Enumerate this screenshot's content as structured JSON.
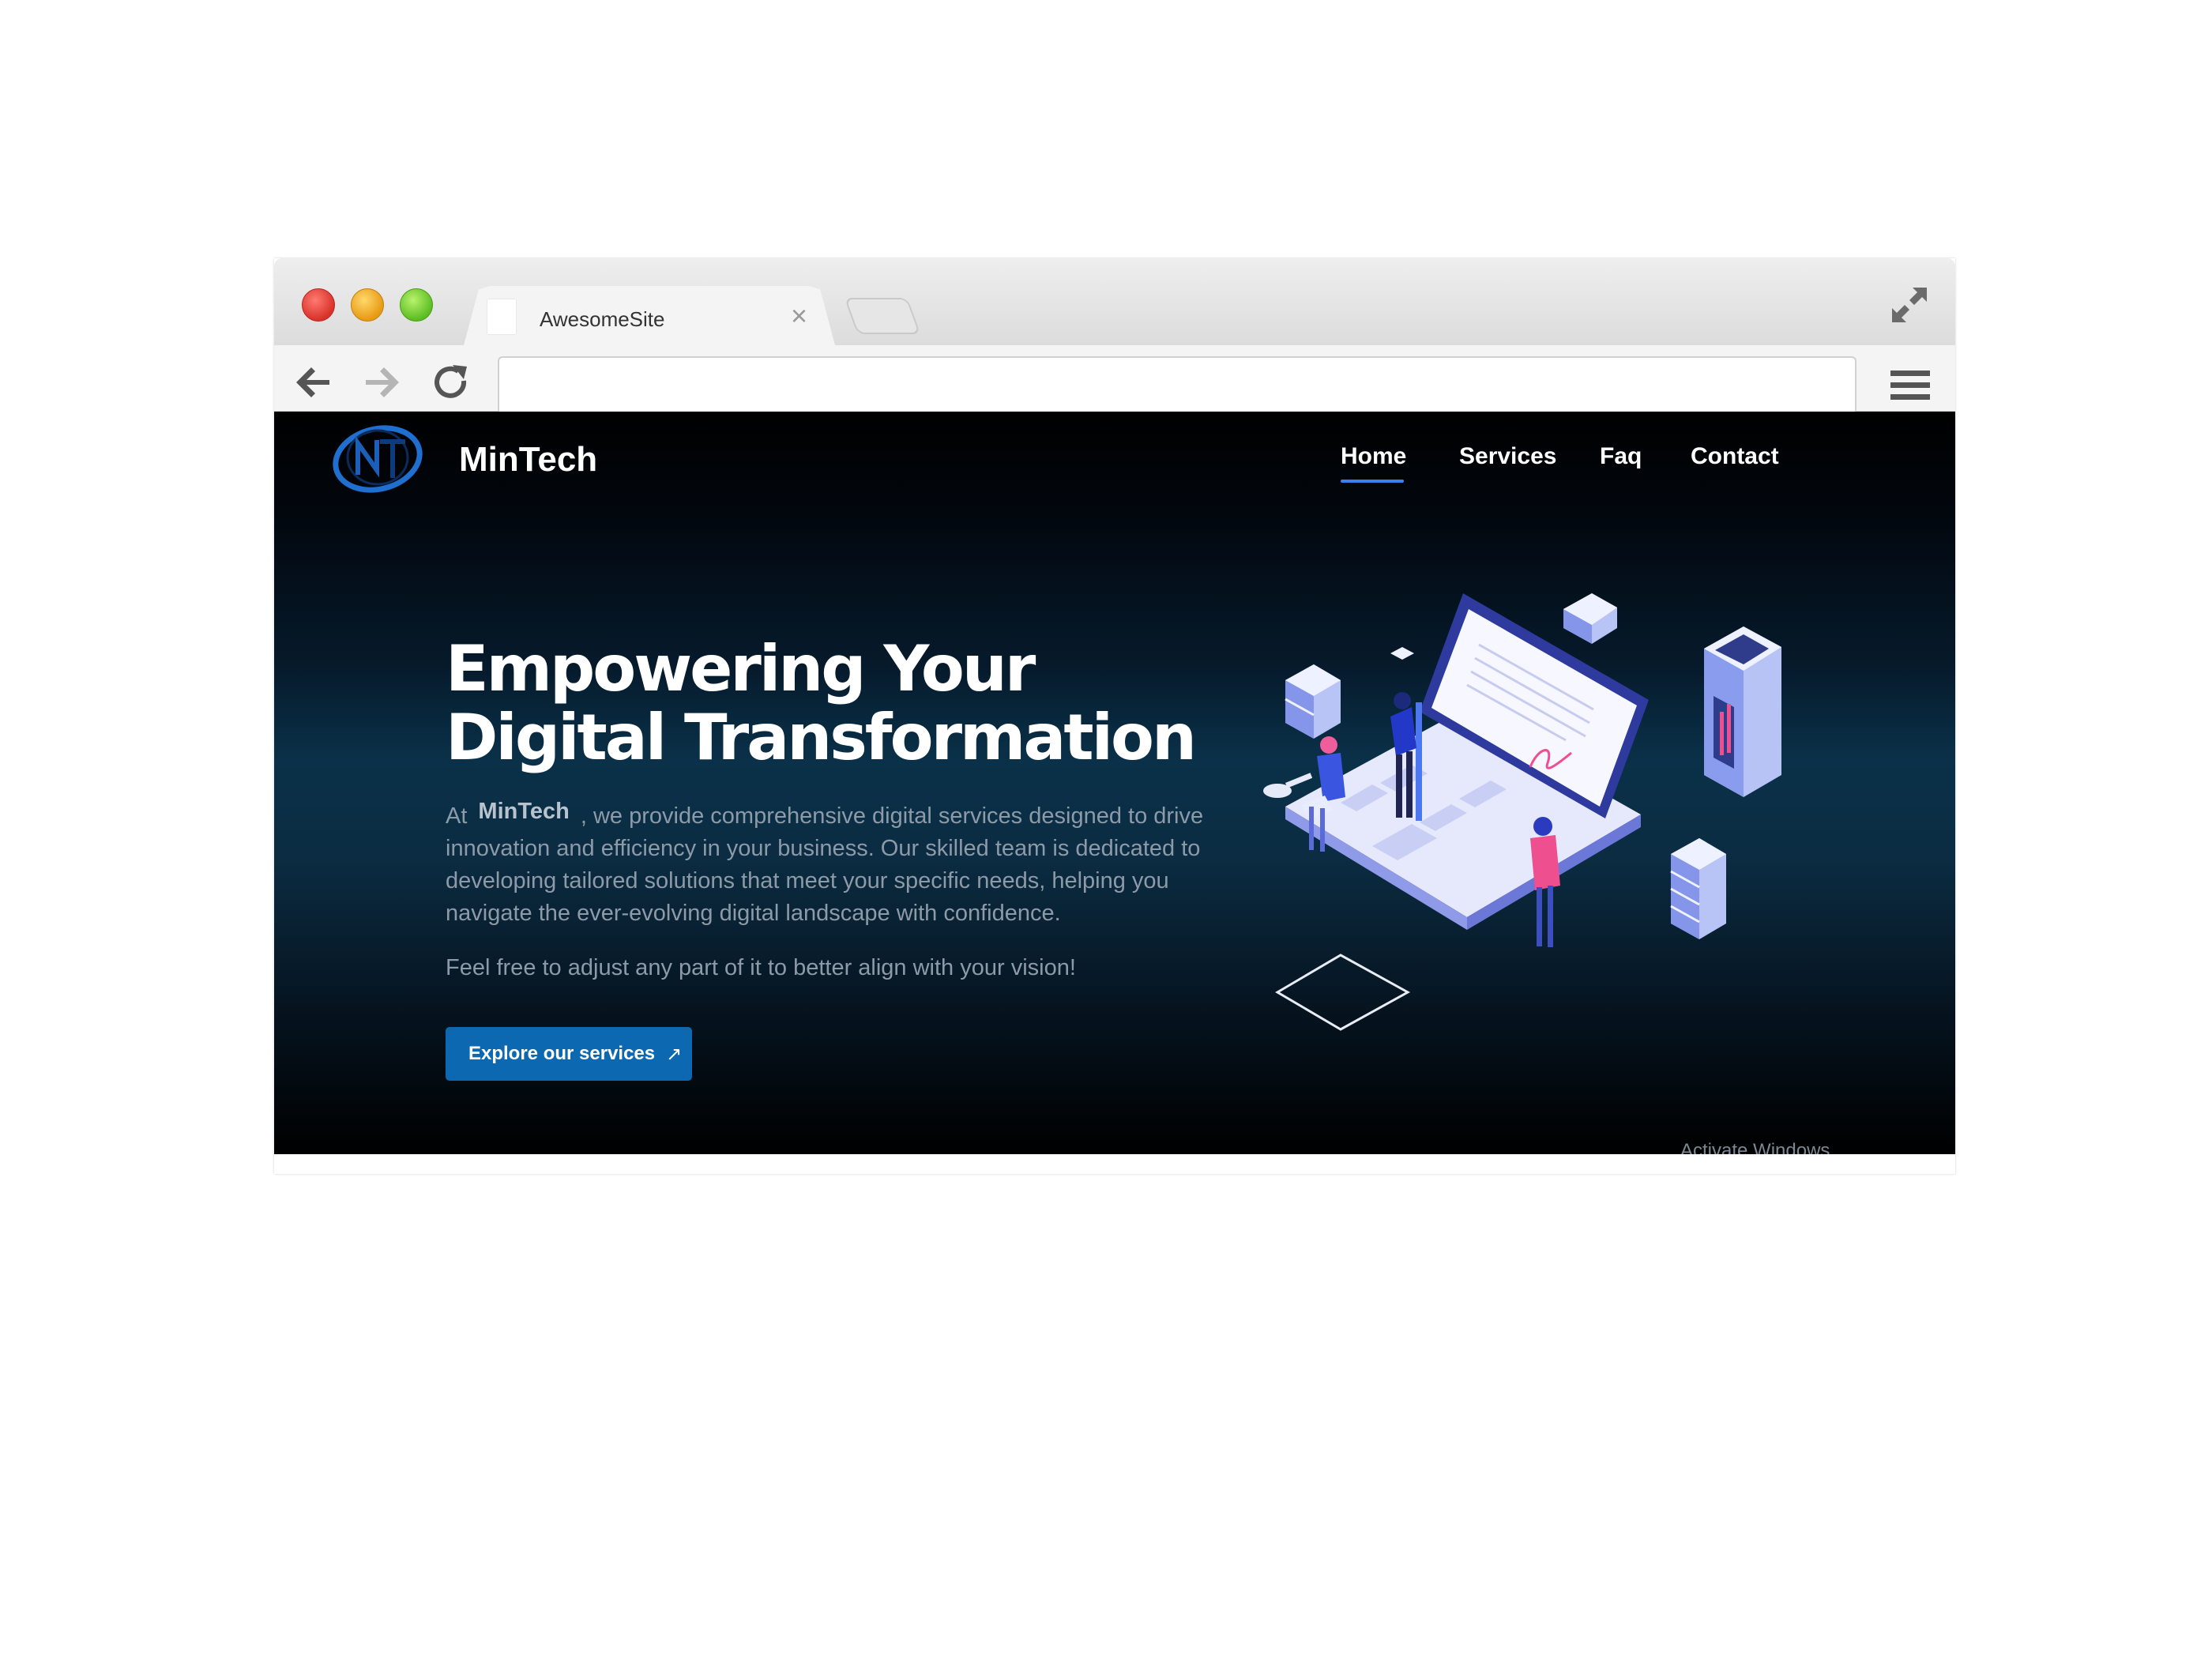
{
  "browser": {
    "tab_title": "AwesomeSite",
    "tab_close": "×",
    "address": ""
  },
  "site": {
    "brand": "MinTech",
    "nav": [
      {
        "label": "Home",
        "active": true
      },
      {
        "label": "Services",
        "active": false
      },
      {
        "label": "Faq",
        "active": false
      },
      {
        "label": "Contact",
        "active": false
      }
    ]
  },
  "hero": {
    "title_line1": "Empowering Your",
    "title_line2": "Digital Transformation",
    "text_prefix": "At",
    "text_brand": "MinTech",
    "text_body": ", we provide comprehensive digital services designed to drive innovation and efficiency in your business. Our skilled team is dedicated to developing tailored solutions that meet your specific needs, helping you navigate the ever-evolving digital landscape with confidence.",
    "note": "Feel free to adjust any part of it to better align with your vision!",
    "cta_label": "Explore our services",
    "cta_icon": "↗"
  },
  "footer_partial": "Activate Windows",
  "icons": {
    "back": "back-arrow-icon",
    "forward": "forward-arrow-icon",
    "reload": "reload-icon",
    "menu": "hamburger-menu-icon",
    "expand": "expand-icon"
  },
  "colors": {
    "accent": "#3f7ef2",
    "cta": "#0c68b0",
    "background_dark": "#000000",
    "background_glow": "#0a3149"
  }
}
